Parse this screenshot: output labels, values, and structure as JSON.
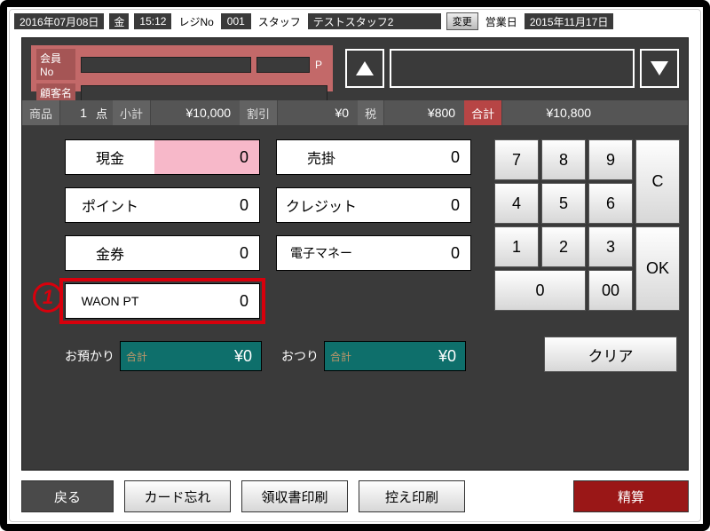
{
  "topbar": {
    "date": "2016年07月08日",
    "day": "金",
    "time": "15:12",
    "reg_no_label": "レジNo",
    "reg_no": "001",
    "staff_label": "スタッフ",
    "staff_name": "テストスタッフ2",
    "change_btn": "変更",
    "biz_day_label": "営業日",
    "biz_day": "2015年11月17日"
  },
  "member": {
    "no_label": "会員No",
    "p_label": "P",
    "name_label": "顧客名"
  },
  "totals": {
    "item_label": "商品",
    "item_qty": "1",
    "item_unit": "点",
    "subtotal_label": "小計",
    "subtotal": "¥10,000",
    "discount_label": "割引",
    "discount": "¥0",
    "tax_label": "税",
    "tax": "¥800",
    "total_label": "合計",
    "total": "¥10,800"
  },
  "payments": {
    "cash_label": "現金",
    "cash_val": "0",
    "uri_label": "売掛",
    "uri_val": "0",
    "point_label": "ポイント",
    "point_val": "0",
    "credit_label": "クレジット",
    "credit_val": "0",
    "voucher_label": "金券",
    "voucher_val": "0",
    "emoney_label": "電子マネー",
    "emoney_val": "0",
    "waon_label": "WAON PT",
    "waon_val": "0"
  },
  "marker1": "1",
  "change": {
    "deposit_label": "お預かり",
    "deposit_tag": "合計",
    "deposit_val": "¥0",
    "change_label": "おつり",
    "change_tag": "合計",
    "change_val": "¥0"
  },
  "keypad": {
    "k7": "7",
    "k8": "8",
    "k9": "9",
    "k4": "4",
    "k5": "5",
    "k6": "6",
    "k1": "1",
    "k2": "2",
    "k3": "3",
    "k0": "0",
    "k00": "00",
    "C": "C",
    "OK": "OK",
    "clear": "クリア"
  },
  "bottom": {
    "back": "戻る",
    "card_forgot": "カード忘れ",
    "receipt_print": "領収書印刷",
    "copy_print": "控え印刷",
    "settle": "精算"
  }
}
